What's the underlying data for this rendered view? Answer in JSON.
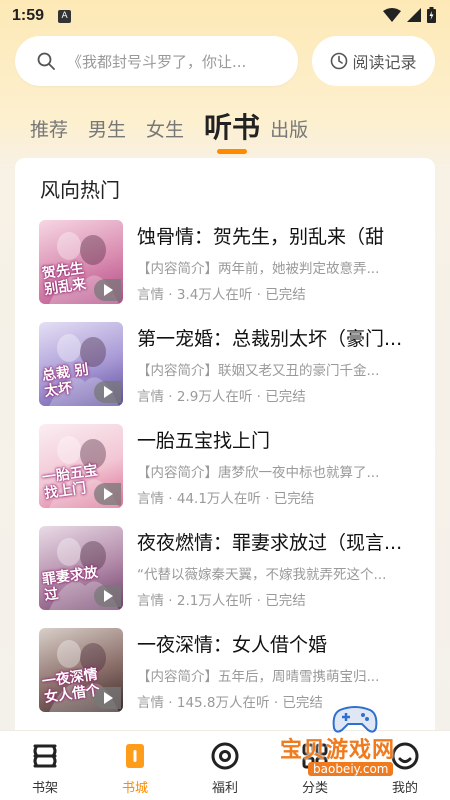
{
  "status_bar": {
    "time": "1:59",
    "a_badge": "A"
  },
  "search": {
    "placeholder": "《我都封号斗罗了，你让...",
    "history_label": "阅读记录"
  },
  "tabs": [
    {
      "label": "推荐"
    },
    {
      "label": "男生"
    },
    {
      "label": "女生"
    },
    {
      "label": "听书"
    },
    {
      "label": "出版"
    }
  ],
  "section": {
    "title": "风向热门"
  },
  "books": [
    {
      "title": "蚀骨情：贺先生，别乱来（甜",
      "intro": "【内容简介】两年前，她被判定故意弄...",
      "meta": "言情 · 3.4万人在听 · 已完结",
      "cover_text": "贺先生 别乱来",
      "cover_colors": [
        "#f6d7e3",
        "#d98bb0",
        "#b04a86"
      ]
    },
    {
      "title": "第一宠婚：总裁别太坏（豪门...",
      "intro": "【内容简介】联姻又老又丑的豪门千金...",
      "meta": "言情 · 2.9万人在听 · 已完结",
      "cover_text": "总裁 别太坏",
      "cover_colors": [
        "#e5dff5",
        "#a99ad6",
        "#5e4d9e"
      ]
    },
    {
      "title": "一胎五宝找上门",
      "intro": "【内容简介】唐梦欣一夜中标也就算了...",
      "meta": "言情 · 44.1万人在听 · 已完结",
      "cover_text": "一胎五宝 找上门",
      "cover_colors": [
        "#fbeef2",
        "#f2c6d4",
        "#d96e92"
      ]
    },
    {
      "title": "夜夜燃情：罪妻求放过（现言...",
      "intro": "“代替以薇嫁秦天翼，不嫁我就弄死这个...",
      "meta": "言情 · 2.1万人在听 · 已完结",
      "cover_text": "罪妻求放过",
      "cover_colors": [
        "#e9dbe6",
        "#b28aa9",
        "#6f3f6a"
      ]
    },
    {
      "title": "一夜深情：女人借个婚",
      "intro": "【内容简介】五年后，周晴雪携萌宝归...",
      "meta": "言情 · 145.8万人在听 · 已完结",
      "cover_text": "一夜深情 女人借个",
      "cover_colors": [
        "#d9cfc9",
        "#8c6f6a",
        "#3b2a2a"
      ]
    }
  ],
  "bottom_nav": [
    {
      "label": "书架",
      "icon": "bookshelf-icon"
    },
    {
      "label": "书城",
      "icon": "bookstore-icon"
    },
    {
      "label": "福利",
      "icon": "welfare-icon"
    },
    {
      "label": "分类",
      "icon": "category-icon"
    },
    {
      "label": "我的",
      "icon": "profile-icon"
    }
  ],
  "watermark": {
    "text": "宝贝游戏网",
    "url": "baobeiy.com"
  },
  "colors": {
    "accent": "#ff8a00",
    "background_top": "#fde9b6",
    "text_muted": "#9a9a9a"
  }
}
